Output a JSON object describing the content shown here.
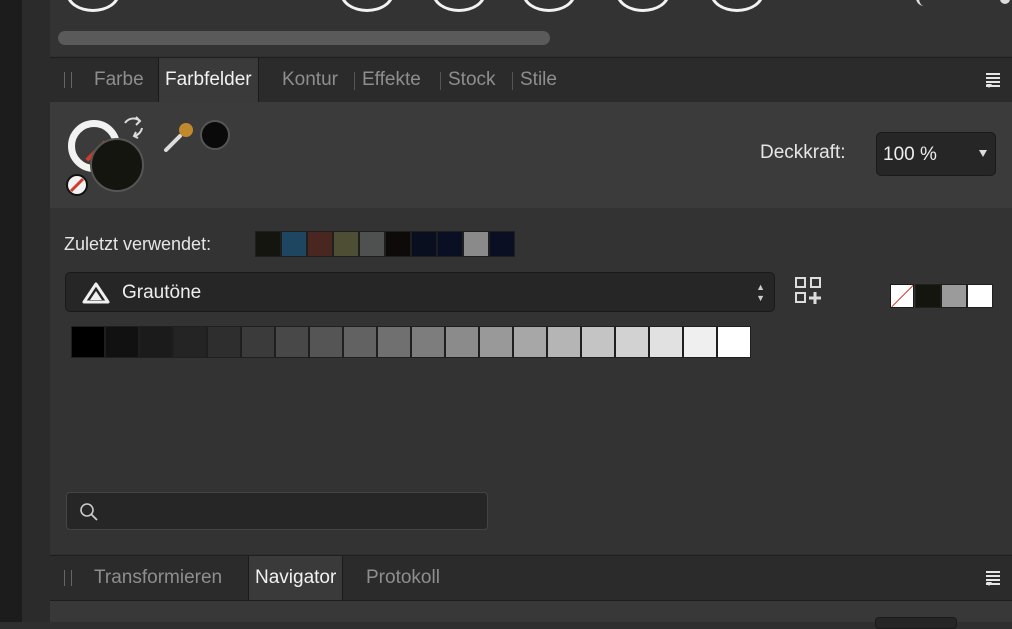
{
  "top": {
    "circle_buttons": [
      "circle-1",
      "circle-2",
      "circle-3",
      "circle-4",
      "circle-5",
      "circle-6"
    ]
  },
  "colors_panel": {
    "tabs": [
      "Farbe",
      "Farbfelder",
      "Kontur",
      "Effekte",
      "Stock",
      "Stile"
    ],
    "active_tab": "Farbfelder",
    "opacity_label": "Deckkraft:",
    "opacity_value": "100 %",
    "recent_label": "Zuletzt verwendet:",
    "recent_colors": [
      "#15150f",
      "#1e4660",
      "#4a2620",
      "#4e4e34",
      "#4f5050",
      "#0f0a0a",
      "#0a0f1f",
      "#0a0f24",
      "#8a8a8a",
      "#0b0f24"
    ],
    "palette_name": "Grautöne",
    "quick_swatches": [
      "#15150f",
      "#9b9b9b",
      "#ffffff"
    ],
    "grays": [
      "#000000",
      "#111111",
      "#1b1b1b",
      "#242424",
      "#2e2e2e",
      "#3b3b3b",
      "#484848",
      "#555555",
      "#626262",
      "#707070",
      "#7d7d7d",
      "#8b8b8b",
      "#999999",
      "#a7a7a7",
      "#b5b5b5",
      "#c4c4c4",
      "#d2d2d2",
      "#e1e1e1",
      "#efefef",
      "#ffffff"
    ],
    "fill_color": "#15150f",
    "picker_color": "#0a0a0a",
    "search_placeholder": ""
  },
  "nav_panel": {
    "tabs": [
      "Transformieren",
      "Navigator",
      "Protokoll"
    ],
    "active_tab": "Navigator"
  },
  "icons": {
    "eyedropper": "eyedropper-icon",
    "swap": "swap-arrow-icon",
    "none": "no-color-icon",
    "add_swatch": "add-swatch-grid-icon",
    "search": "search-icon",
    "palette": "palette-triangle-icon",
    "menu": "panel-menu-icon"
  }
}
